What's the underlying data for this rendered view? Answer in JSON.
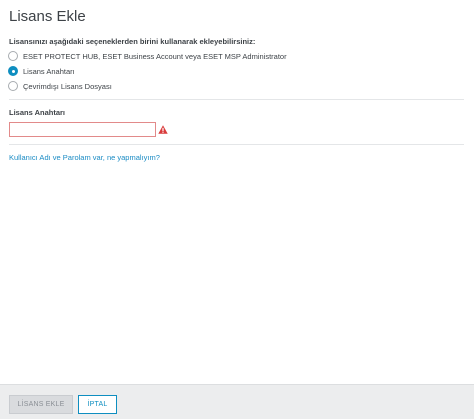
{
  "dialog": {
    "title": "Lisans Ekle",
    "prompt": "Lisansınızı aşağıdaki seçeneklerden birini kullanarak ekleyebilirsiniz:",
    "options": [
      {
        "label": "ESET PROTECT HUB, ESET Business Account veya ESET MSP Administrator",
        "selected": false
      },
      {
        "label": "Lisans Anahtarı",
        "selected": true
      },
      {
        "label": "Çevrimdışı Lisans Dosyası",
        "selected": false
      }
    ],
    "license_key": {
      "label": "Lisans Anahtarı",
      "value": "",
      "placeholder": "",
      "status": "error"
    },
    "help_link": "Kullanıcı Adı ve Parolam var, ne yapmalıyım?"
  },
  "footer": {
    "add_label": "LİSANS EKLE",
    "cancel_label": "İPTAL"
  },
  "colors": {
    "accent": "#0e8ec0",
    "error": "#d93b3b",
    "link": "#1a8bc4"
  }
}
